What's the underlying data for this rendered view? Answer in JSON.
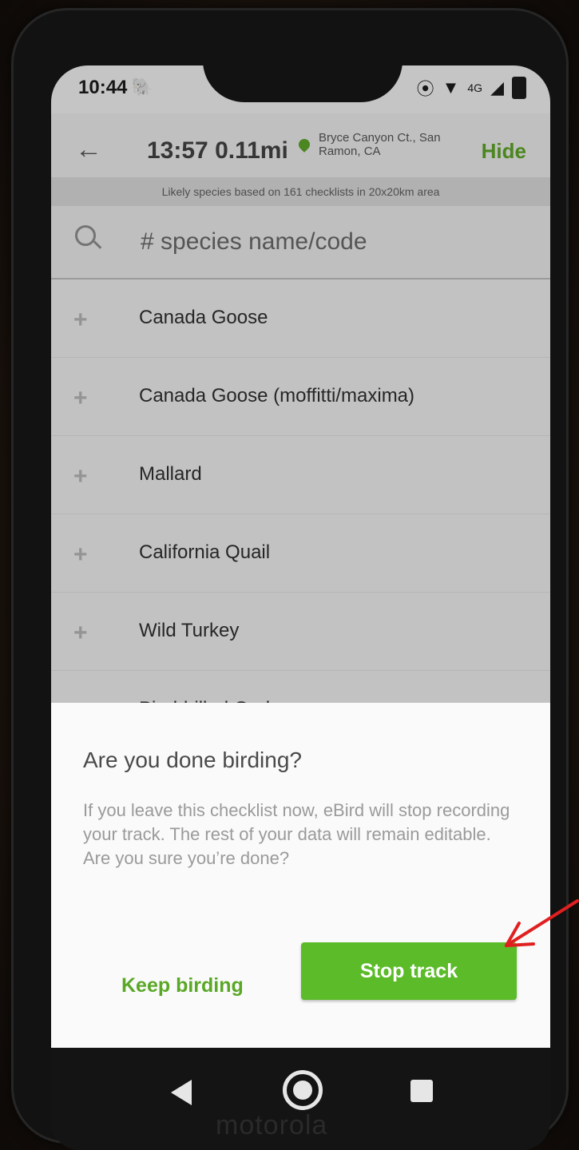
{
  "status_bar": {
    "time": "10:44",
    "app_icon": "elephant-icon",
    "icons": [
      "location-icon",
      "wifi-icon",
      "4g-icon",
      "signal-icon",
      "battery-icon"
    ],
    "network": "4G"
  },
  "app_bar": {
    "back_icon": "arrow-left-icon",
    "trip_stats": "13:57 0.11mi",
    "location": "Bryce Canyon Ct., San Ramon, CA",
    "hide_label": "Hide"
  },
  "subtitle": "Likely species based on 161 checklists in 20x20km area",
  "search": {
    "placeholder": "# species name/code"
  },
  "species": [
    "Canada Goose",
    "Canada Goose (moffitti/maxima)",
    "Mallard",
    "California Quail",
    "Wild Turkey",
    "Pied-billed Grebe"
  ],
  "dialog": {
    "title": "Are you done birding?",
    "body": "If you leave this checklist now, eBird will stop recording your track. The rest of your data will remain editable. Are you sure you’re done?",
    "keep_label": "Keep birding",
    "stop_label": "Stop track"
  },
  "device_brand": "motorola",
  "colors": {
    "accent_green": "#5bbb28",
    "arrow_red": "#e02020"
  }
}
